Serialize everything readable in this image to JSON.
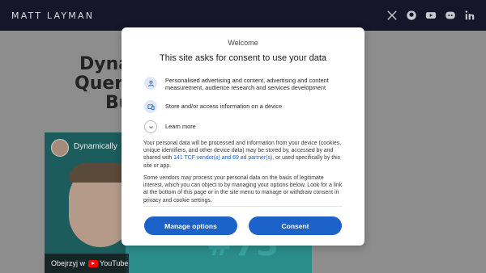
{
  "header": {
    "site_title": "MATT LAYMAN",
    "social_icons": [
      "x-icon",
      "github-icon",
      "youtube-icon",
      "discord-icon",
      "linkedin-icon"
    ]
  },
  "article": {
    "title_line1": "Dyna",
    "title_line2": "Query",
    "title_line3": "Bu"
  },
  "video": {
    "title": "Dynamically",
    "watch_label": "Obejrzyj w",
    "platform": "YouTube",
    "badge": "#73"
  },
  "consent": {
    "welcome": "Welcome",
    "title": "This site asks for consent to use your data",
    "purposes": [
      {
        "icon": "person-icon",
        "label": "Personalised advertising and content, advertising and content measurement, audience research and services development"
      },
      {
        "icon": "device-icon",
        "label": "Store and/or access information on a device"
      },
      {
        "icon": "chevron-down-icon",
        "label": "Learn more"
      }
    ],
    "info1_pre": "Your personal data will be processed and information from your device (cookies, unique identifiers, and other device data) may be stored by, accessed by and shared with ",
    "info1_link": "141 TCF vendor(s) and 69 ad partner(s)",
    "info1_post": ", or used specifically by this site or app.",
    "info2": "Some vendors may process your personal data on the basis of legitimate interest, which you can object to by managing your options below. Look for a link at the bottom of this page or in the site menu to manage or withdraw consent in privacy and cookie settings.",
    "manage_label": "Manage options",
    "consent_label": "Consent",
    "accent_color": "#1d62c9"
  }
}
